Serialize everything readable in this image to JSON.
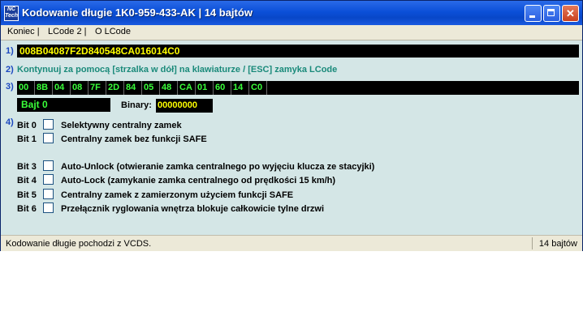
{
  "window": {
    "app_icon_text": "NC\nTech",
    "title": "Kodowanie długie   1K0-959-433-AK  |  14 bajtów"
  },
  "menu": [
    "Koniec |",
    "LCode 2 |",
    "O LCode"
  ],
  "section_numbers": [
    "1)",
    "2)",
    "3)",
    "4)"
  ],
  "coding_string": "008B04087F2D840548CA016014C0",
  "hint": "Kontynuuj za pomocą [strzalka w dół] na klawiaturze / [ESC] zamyka LCode",
  "bytes": [
    "00",
    "8B",
    "04",
    "08",
    "7F",
    "2D",
    "84",
    "05",
    "48",
    "CA",
    "01",
    "60",
    "14",
    "C0"
  ],
  "selected_byte_label": "Bajt 0",
  "binary": {
    "label": "Binary:",
    "value": "00000000"
  },
  "bits": [
    {
      "label": "Bit 0",
      "text": "Selektywny centralny zamek",
      "checked": false
    },
    {
      "label": "Bit 1",
      "text": "Centralny zamek bez funkcji SAFE",
      "checked": false
    },
    {
      "label": "Bit 3",
      "text": "Auto-Unlock (otwieranie zamka centralnego po wyjęciu klucza ze stacyjki)",
      "checked": false
    },
    {
      "label": "Bit 4",
      "text": "Auto-Lock (zamykanie zamka centralnego od prędkości 15 km/h)",
      "checked": false
    },
    {
      "label": "Bit 5",
      "text": "Centralny zamek z zamierzonym użyciem funkcji SAFE",
      "checked": false
    },
    {
      "label": "Bit 6",
      "text": "Przełącznik ryglowania wnętrza blokuje całkowicie tylne drzwi",
      "checked": false
    }
  ],
  "status": {
    "left": "Kodowanie długie pochodzi z VCDS.",
    "right": "14 bajtów"
  },
  "colors": {
    "title_bar": "#0b4fd8",
    "window_bg": "#d4e6e6",
    "code_yellow": "#ffff00",
    "byte_green": "#3aff3a",
    "hint_teal": "#1a8a7a"
  }
}
